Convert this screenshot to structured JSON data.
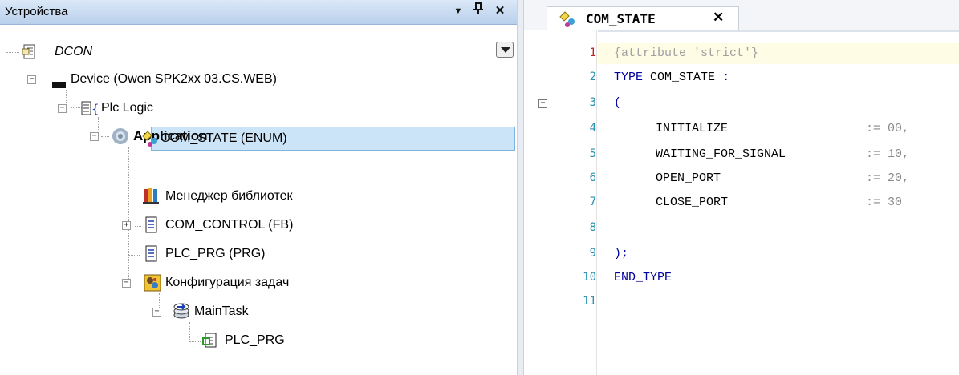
{
  "devices_panel": {
    "title": "Устройства",
    "buttons": {
      "dropdown": "▼",
      "pin": "ᵖ",
      "close": "✕"
    },
    "tree": {
      "root": "DCON",
      "device": "Device (Owen SPK2xx 03.CS.WEB)",
      "plc_logic": "Plc Logic",
      "application": "Application",
      "com_state": "COM_STATE (ENUM)",
      "library_manager": "Менеджер библиотек",
      "com_control": "COM_CONTROL (FB)",
      "plc_prg": "PLC_PRG (PRG)",
      "task_config": "Конфигурация задач",
      "main_task": "MainTask",
      "plc_prg_call": "PLC_PRG"
    },
    "icons": {
      "root": "project-file-icon",
      "device": "device-icon",
      "plc_logic": "plc-logic-icon",
      "application": "application-gear-icon",
      "com_state": "enum-type-icon",
      "library_manager": "library-books-icon",
      "com_control": "pou-document-icon",
      "task_config": "task-configuration-icon",
      "main_task": "task-icon",
      "plc_prg_call": "program-call-icon"
    }
  },
  "editor": {
    "tab": {
      "label": "COM_STATE",
      "close": "✕"
    },
    "line_numbers": [
      "1",
      "2",
      "3",
      "4",
      "5",
      "6",
      "7",
      "8",
      "9",
      "10",
      "11"
    ],
    "lines": {
      "l1": "{attribute 'strict'}",
      "l2_kw": "TYPE",
      "l2_name": "COM_STATE",
      "l2_colon": ":",
      "l3": "(",
      "l4_name": "INITIALIZE",
      "l4_val": ":= 00,",
      "l5_name": "WAITING_FOR_SIGNAL",
      "l5_val": ":= 10,",
      "l6_name": "OPEN_PORT",
      "l6_val": ":= 20,",
      "l7_name": "CLOSE_PORT",
      "l7_val": ":= 30",
      "l9": ");",
      "l10": "END_TYPE"
    },
    "colors": {
      "keyword": "#00009c",
      "attribute": "#a0a0a0",
      "line_number": "#2b91af",
      "selection": "#cce4f7"
    }
  }
}
